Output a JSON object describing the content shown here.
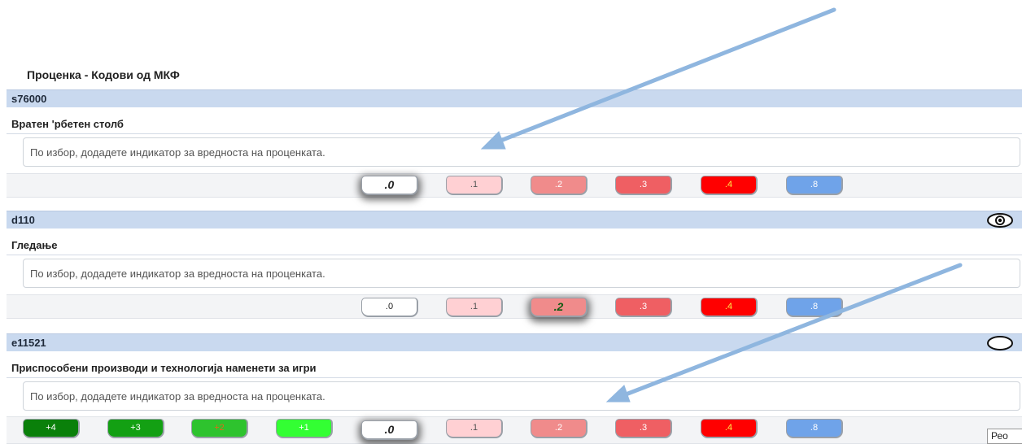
{
  "section_title": "Проценка - Кодови од МКФ",
  "note_placeholder": "По избор, додадете индикатор за вредноста на проценката.",
  "qualifier_labels": {
    "b0": ".0",
    "b1": ".1",
    "b2": ".2",
    "b3": ".3",
    "b4": ".4",
    "b8": ".8",
    "p4": "+4",
    "p3": "+3",
    "p2": "+2",
    "p1": "+1"
  },
  "items": [
    {
      "code": "s76000",
      "name": "Вратен 'рбетен столб",
      "header_icon": "",
      "selected_qualifier": ".0"
    },
    {
      "code": "d110",
      "name": "Гледање",
      "header_icon": "eye-icon",
      "selected_qualifier": ".2"
    },
    {
      "code": "e11521",
      "name": "Приспособени производи и технологија наменети за игри",
      "header_icon": "oval-icon",
      "selected_qualifier": ".0"
    }
  ],
  "truncated_button_label": "Рео",
  "colors": {
    "header_bg": "#c9d9ef",
    "q1": "#ffd0d3",
    "q2": "#f08b8b",
    "q3": "#ef5f63",
    "q4": "#ff0000",
    "q8": "#6fa3e9",
    "plus4": "#0a800a",
    "plus3": "#13a013",
    "plus2": "#2ec32e",
    "plus1": "#33ff33",
    "annotation_arrow": "#8fb6df"
  }
}
